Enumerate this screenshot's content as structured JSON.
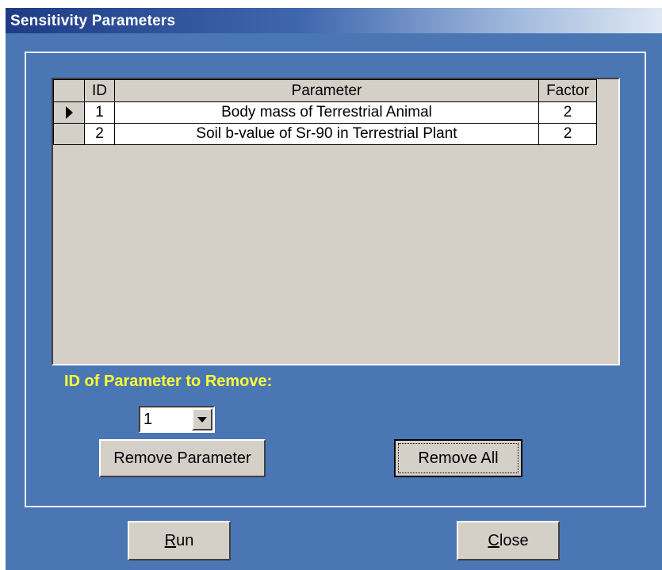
{
  "window": {
    "title": "Sensitivity Parameters"
  },
  "grid": {
    "columns": [
      "ID",
      "Parameter",
      "Factor"
    ],
    "rows": [
      {
        "id": "1",
        "parameter": "Body mass of Terrestrial Animal",
        "factor": "2",
        "selected": true
      },
      {
        "id": "2",
        "parameter": "Soil b-value of Sr-90 in Terrestrial Plant",
        "factor": "2",
        "selected": false
      }
    ]
  },
  "remove": {
    "label": "ID of Parameter to Remove:",
    "selected_id": "1",
    "remove_parameter_button": "Remove Parameter",
    "remove_all_button": "Remove All"
  },
  "footer": {
    "run_button": {
      "mnemonic": "R",
      "rest": "un"
    },
    "close_button": {
      "mnemonic": "C",
      "rest": "lose"
    }
  },
  "colors": {
    "window_bg": "#4a76b4",
    "label_color": "#ffff33",
    "control_face": "#d4d0c8"
  }
}
